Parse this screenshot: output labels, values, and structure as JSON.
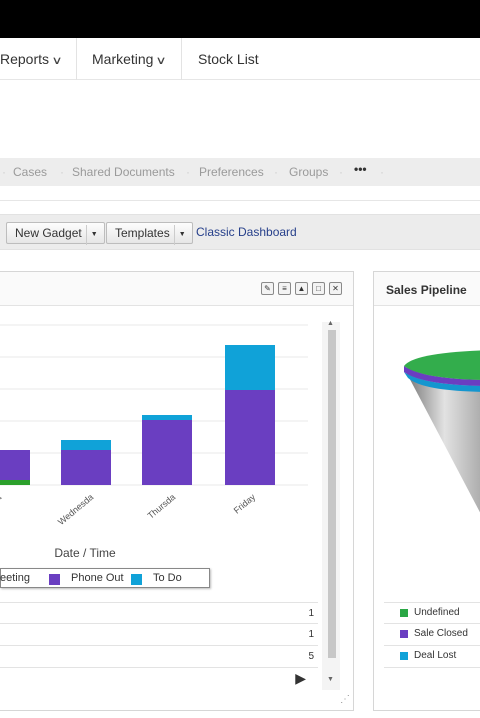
{
  "nav": {
    "items": [
      {
        "label": "Reports"
      },
      {
        "label": "Marketing"
      },
      {
        "label": "Stock List"
      }
    ]
  },
  "subnav": {
    "items": [
      "Cases",
      "Shared Documents",
      "Preferences",
      "Groups"
    ],
    "more": "•••"
  },
  "toolbar": {
    "new_gadget": "New Gadget",
    "templates": "Templates",
    "classic_dashboard": "Classic Dashboard"
  },
  "activity_gadget": {
    "controls": [
      "edit-icon",
      "pin-icon",
      "collapse-icon",
      "maximize-icon",
      "close-icon"
    ],
    "chart_data": {
      "type": "bar",
      "stacked": true,
      "categories": [
        "Tuesday",
        "Wednesday",
        "Thursday",
        "Friday"
      ],
      "series": [
        {
          "name": "Meeting",
          "color": "#2ca02c",
          "values": [
            1,
            0,
            0,
            0
          ]
        },
        {
          "name": "Phone Out",
          "color": "#6a3ec1",
          "values": [
            6,
            7,
            13,
            19
          ]
        },
        {
          "name": "To Do",
          "color": "#10a2d8",
          "values": [
            0,
            2,
            1,
            9
          ]
        }
      ],
      "xlabel": "Date / Time",
      "legend_position": "bottom",
      "grid": true
    },
    "tick_labels": [
      "la",
      "Wednesda",
      "Thursda",
      "Friday"
    ],
    "legend": [
      {
        "label": "eeting",
        "color": "#2ca02c"
      },
      {
        "label": "Phone Out",
        "color": "#6a3ec1"
      },
      {
        "label": "To Do",
        "color": "#10a2d8"
      }
    ],
    "table_values": [
      "1",
      "1",
      "5"
    ]
  },
  "sales_pipeline": {
    "title": "Sales Pipeline",
    "legend": [
      {
        "label": "Undefined",
        "color": "#2aa745"
      },
      {
        "label": "Sale Closed",
        "color": "#6a3ec1"
      },
      {
        "label": "Deal Lost",
        "color": "#10a2d8"
      }
    ]
  }
}
